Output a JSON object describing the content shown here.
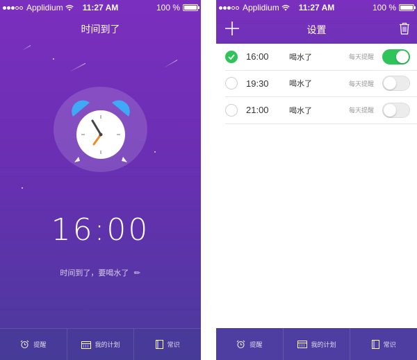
{
  "status_bar": {
    "carrier": "Applidium",
    "time": "11:27 AM",
    "battery": "100 %"
  },
  "left_screen": {
    "title": "时间到了",
    "alarm_time": "16:00",
    "message": "时间到了，要喝水了",
    "clock_icon": "alarm-clock-icon"
  },
  "right_screen": {
    "title": "设置",
    "alarms": [
      {
        "time": "16:00",
        "label": "喝水了",
        "repeat": "每天提醒",
        "checked": true,
        "enabled": true
      },
      {
        "time": "19:30",
        "label": "喝水了",
        "repeat": "每天提醒",
        "checked": false,
        "enabled": false
      },
      {
        "time": "21:00",
        "label": "喝水了",
        "repeat": "每天提醒",
        "checked": false,
        "enabled": false
      }
    ]
  },
  "tabbar": {
    "tabs": [
      {
        "label": "提醒",
        "icon": "alarm-icon"
      },
      {
        "label": "我的计划",
        "icon": "calendar-icon"
      },
      {
        "label": "常识",
        "icon": "book-icon"
      }
    ]
  },
  "colors": {
    "purple": "#7b2fbe",
    "indigo": "#4f3ea2",
    "green": "#2ec45a",
    "clock_blue": "#3fa9f5",
    "hand_orange": "#f08a24"
  }
}
